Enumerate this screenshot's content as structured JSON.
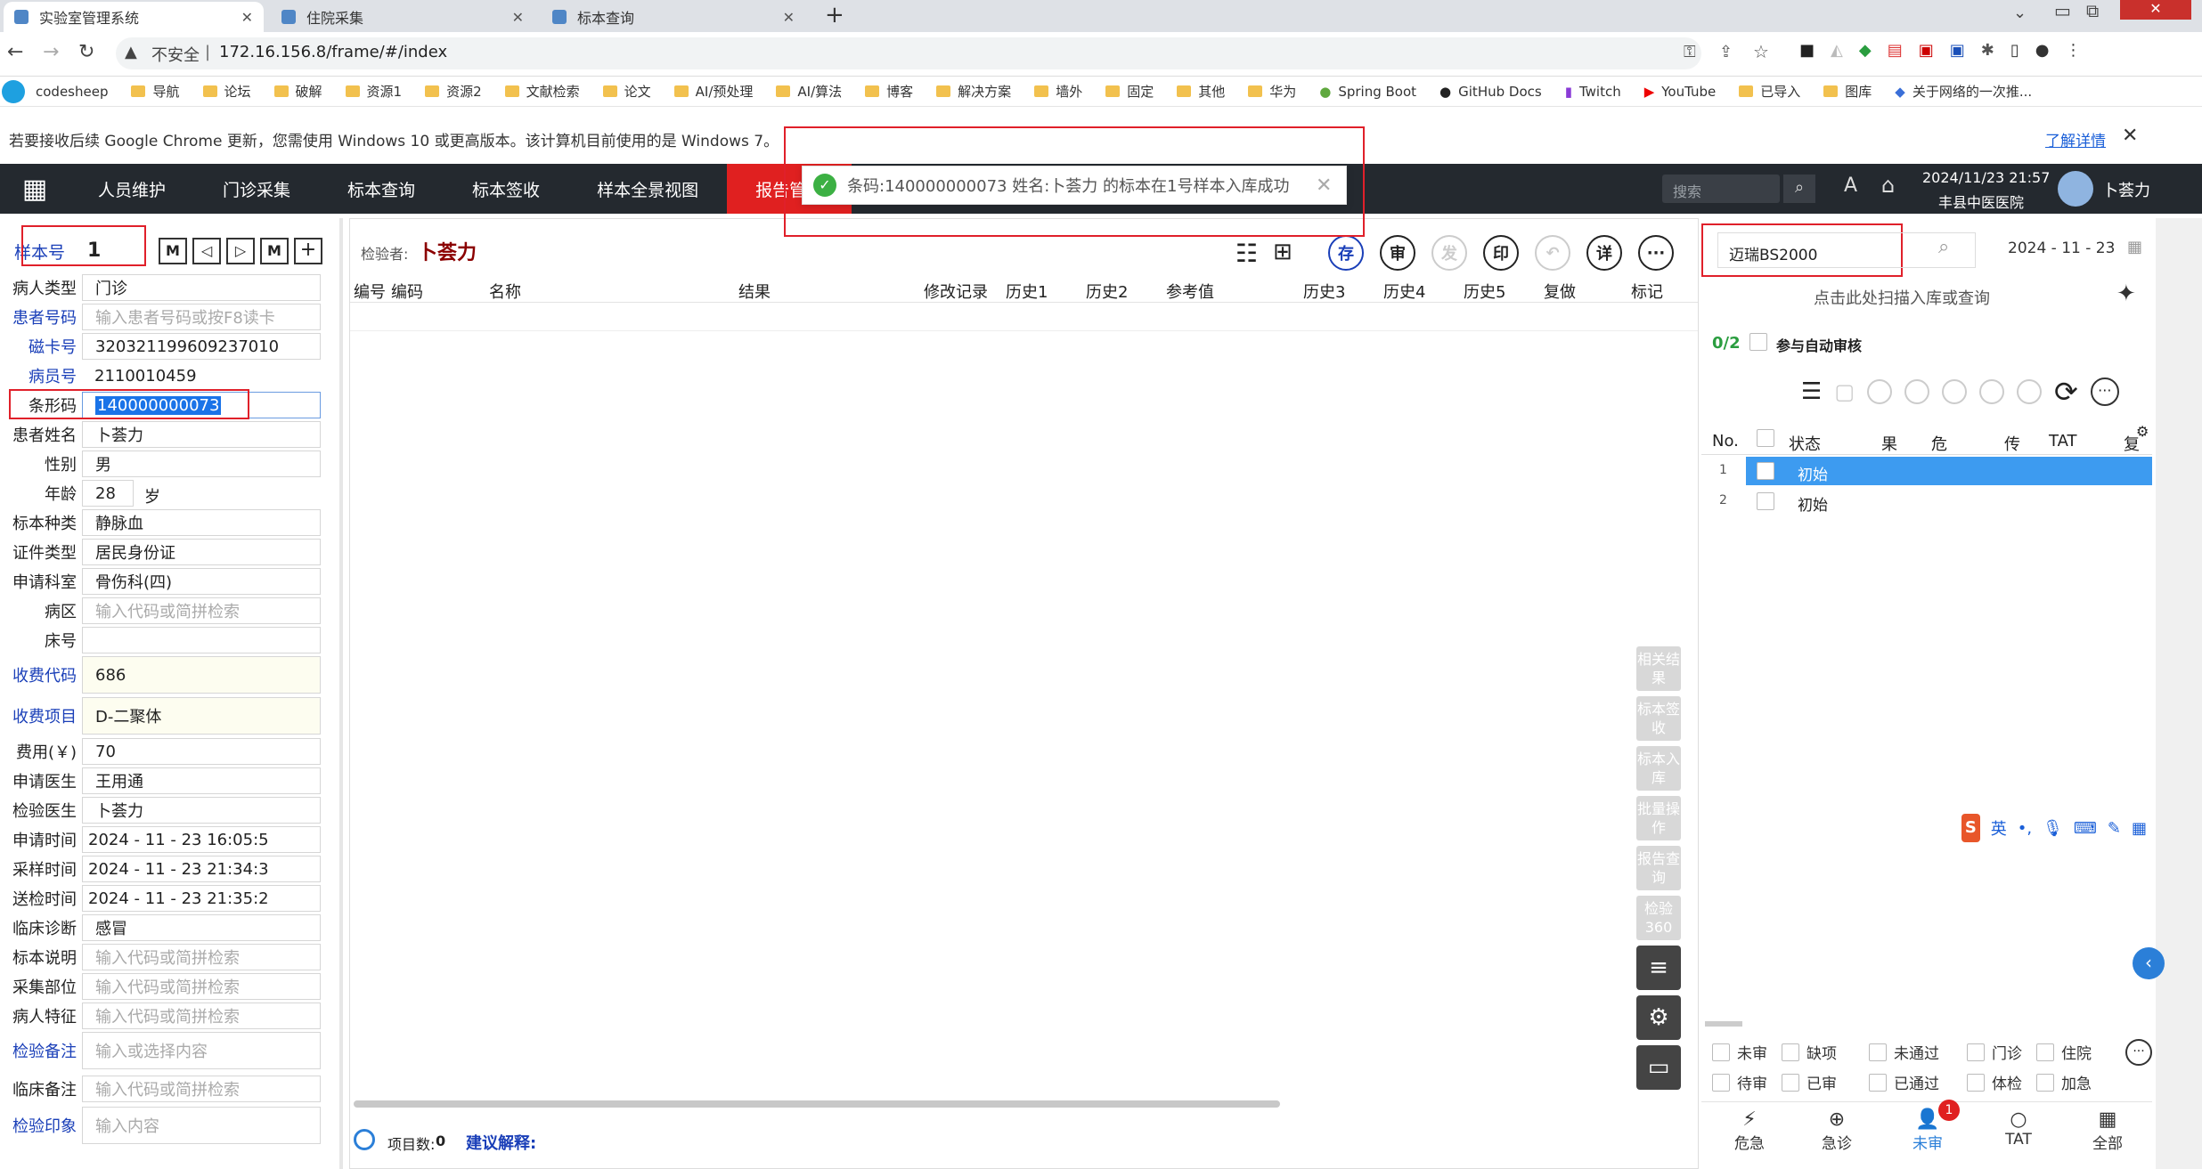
{
  "browser": {
    "tabs": [
      {
        "label": "实验室管理系统",
        "active": true
      },
      {
        "label": "住院采集",
        "active": false
      },
      {
        "label": "标本查询",
        "active": false
      }
    ],
    "new_tab": "+",
    "security": "不安全",
    "url": "172.16.156.8/frame/#/index",
    "bookmarks": [
      "codesheep",
      "导航",
      "论坛",
      "破解",
      "资源1",
      "资源2",
      "文献检索",
      "论文",
      "AI/预处理",
      "AI/算法",
      "博客",
      "解决方案",
      "墙外",
      "固定",
      "其他",
      "华为",
      "Spring Boot",
      "GitHub Docs",
      "Twitch",
      "YouTube",
      "已导入",
      "图库",
      "关于网络的一次推..."
    ],
    "update_notice": "若要接收后续 Google Chrome 更新，您需使用 Windows 10 或更高版本。该计算机目前使用的是 Windows 7。",
    "learn_more": "了解详情"
  },
  "nav": {
    "items": [
      "人员维护",
      "门诊采集",
      "标本查询",
      "标本签收",
      "样本全景视图",
      "报告管理"
    ],
    "active_index": 5,
    "search_placeholder": "搜索",
    "datetime": "2024/11/23 21:57",
    "hospital": "丰县中医医院",
    "user": "卜荟力"
  },
  "toast": {
    "message": "条码:140000000073 姓名:卜荟力 的标本在1号样本入库成功"
  },
  "form": {
    "sample_no_label": "样本号",
    "sample_no": "1",
    "fields": [
      {
        "label": "病人类型",
        "value": "门诊",
        "placeholder": false,
        "blue": false
      },
      {
        "label": "患者号码",
        "value": "输入患者号码或按F8读卡",
        "placeholder": true,
        "blue": true
      },
      {
        "label": "磁卡号",
        "value": "320321199609237010",
        "placeholder": false,
        "blue": true
      },
      {
        "label": "病员号",
        "value": "2110010459",
        "placeholder": false,
        "blue": true
      },
      {
        "label": "条形码",
        "value": "140000000073",
        "placeholder": false,
        "blue": false
      },
      {
        "label": "患者姓名",
        "value": "卜荟力",
        "placeholder": false,
        "blue": false
      },
      {
        "label": "性别",
        "value": "男",
        "placeholder": false,
        "blue": false
      },
      {
        "label": "年龄",
        "value": "28",
        "placeholder": false,
        "blue": false
      },
      {
        "label": "标本种类",
        "value": "静脉血",
        "placeholder": false,
        "blue": false
      },
      {
        "label": "证件类型",
        "value": "居民身份证",
        "placeholder": false,
        "blue": false
      },
      {
        "label": "申请科室",
        "value": "骨伤科(四)",
        "placeholder": false,
        "blue": false
      },
      {
        "label": "病区",
        "value": "输入代码或简拼检索",
        "placeholder": true,
        "blue": false
      },
      {
        "label": "床号",
        "value": "",
        "placeholder": false,
        "blue": false
      },
      {
        "label": "收费代码",
        "value": "686",
        "placeholder": false,
        "blue": true
      },
      {
        "label": "收费项目",
        "value": "D-二聚体",
        "placeholder": false,
        "blue": true
      },
      {
        "label": "费用(￥)",
        "value": "70",
        "placeholder": false,
        "blue": false
      },
      {
        "label": "申请医生",
        "value": "王用通",
        "placeholder": false,
        "blue": false
      },
      {
        "label": "检验医生",
        "value": "卜荟力",
        "placeholder": false,
        "blue": false
      },
      {
        "label": "申请时间",
        "value": "2024 - 11 - 23   16:05:5",
        "placeholder": false,
        "blue": false
      },
      {
        "label": "采样时间",
        "value": "2024 - 11 - 23   21:34:3",
        "placeholder": false,
        "blue": false
      },
      {
        "label": "送检时间",
        "value": "2024 - 11 - 23   21:35:2",
        "placeholder": false,
        "blue": false
      },
      {
        "label": "临床诊断",
        "value": "感冒",
        "placeholder": false,
        "blue": false
      },
      {
        "label": "标本说明",
        "value": "输入代码或简拼检索",
        "placeholder": true,
        "blue": false
      },
      {
        "label": "采集部位",
        "value": "输入代码或简拼检索",
        "placeholder": true,
        "blue": false
      },
      {
        "label": "病人特征",
        "value": "输入代码或简拼检索",
        "placeholder": true,
        "blue": false
      },
      {
        "label": "检验备注",
        "value": "输入或选择内容",
        "placeholder": true,
        "blue": true
      },
      {
        "label": "临床备注",
        "value": "输入代码或简拼检索",
        "placeholder": true,
        "blue": false
      },
      {
        "label": "检验印象",
        "value": "输入内容",
        "placeholder": true,
        "blue": true
      }
    ],
    "age_unit": "岁"
  },
  "middle": {
    "tester_label": "检验者:",
    "tester": "卜荟力",
    "buttons": [
      "存",
      "审",
      "发",
      "印",
      "详"
    ],
    "columns": [
      "编号",
      "编码",
      "名称",
      "结果",
      "修改记录",
      "历史1",
      "历史2",
      "参考值",
      "历史3",
      "历史4",
      "历史5",
      "复做",
      "标记"
    ],
    "side_buttons": [
      "相关结果",
      "标本签收",
      "标本入库",
      "批量操作",
      "报告查询",
      "检验360"
    ],
    "item_count_label": "项目数:",
    "item_count": "0",
    "suggestion_label": "建议解释:"
  },
  "right": {
    "instrument": "迈瑞BS2000",
    "date": "2024 - 11 - 23",
    "scan_hint": "点击此处扫描入库或查询",
    "progress": "0/2",
    "auto_review": "参与自动审核",
    "columns": [
      "No.",
      "状态",
      "果",
      "危",
      "传",
      "TAT",
      "复"
    ],
    "rows": [
      {
        "no": "1",
        "status": "初始",
        "selected": true
      },
      {
        "no": "2",
        "status": "初始",
        "selected": false
      }
    ],
    "filters": [
      "未审",
      "缺项",
      "未通过",
      "门诊",
      "住院",
      "待审",
      "已审",
      "已通过",
      "体检",
      "加急"
    ],
    "bottom_tabs": [
      "危急",
      "急诊",
      "未审",
      "TAT",
      "全部"
    ],
    "badge": "1"
  },
  "ime": {
    "label": "英"
  }
}
